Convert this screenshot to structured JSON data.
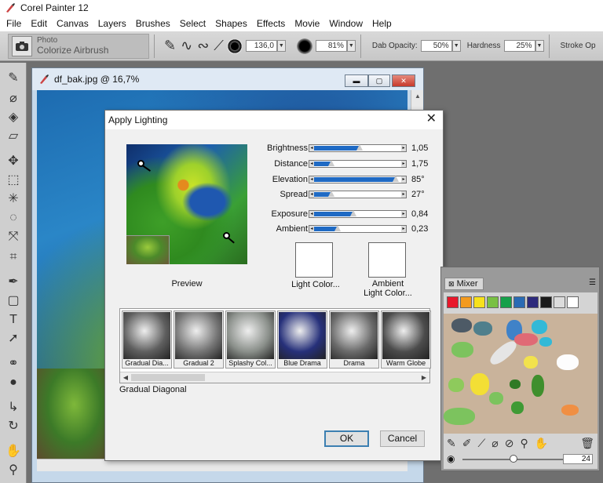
{
  "app": {
    "title": "Corel Painter 12",
    "icon": "painter-brush-icon"
  },
  "menu": [
    "File",
    "Edit",
    "Canvas",
    "Layers",
    "Brushes",
    "Select",
    "Shapes",
    "Effects",
    "Movie",
    "Window",
    "Help"
  ],
  "propbar": {
    "brush_category": "Photo",
    "brush_variant": "Colorize Airbrush",
    "size_value": "136,0",
    "opacity_value": "81%",
    "dab_opacity_label": "Dab Opacity:",
    "dab_opacity_value": "50%",
    "hardness_label": "Hardness",
    "hardness_value": "25%",
    "stroke_label": "Stroke Op"
  },
  "document": {
    "title": "df_bak.jpg @ 16,7%"
  },
  "dialog": {
    "title": "Apply Lighting",
    "preview_label": "Preview",
    "sliders": [
      {
        "label": "Brightness",
        "value": "1,05",
        "fraction": 0.52
      },
      {
        "label": "Distance",
        "value": "1,75",
        "fraction": 0.2
      },
      {
        "label": "Elevation",
        "value": "85°",
        "fraction": 0.94
      },
      {
        "label": "Spread",
        "value": "27°",
        "fraction": 0.2
      },
      {
        "label": "Exposure",
        "value": "0,84",
        "fraction": 0.45
      },
      {
        "label": "Ambient",
        "value": "0,23",
        "fraction": 0.27
      }
    ],
    "light_color_label": "Light Color...",
    "ambient_color_label_1": "Ambient",
    "ambient_color_label_2": "Light Color...",
    "library": [
      {
        "name": "Gradual Dia...",
        "color": "#5f5f5f"
      },
      {
        "name": "Gradual 2",
        "color": "#767676"
      },
      {
        "name": "Splashy Col...",
        "color": "#8a8f8a"
      },
      {
        "name": "Blue Drama",
        "color": "#26307a"
      },
      {
        "name": "Drama",
        "color": "#6a6a6a"
      },
      {
        "name": "Warm Globe",
        "color": "#4c4c4c"
      }
    ],
    "selected_name": "Gradual Diagonal",
    "ok_label": "OK",
    "cancel_label": "Cancel"
  },
  "mixer": {
    "title": "Mixer",
    "swatches": [
      "#e8182b",
      "#f39a1e",
      "#f7e11b",
      "#79c043",
      "#16a04a",
      "#2a6bb4",
      "#2d2a7c",
      "#1a1a1a",
      "#dcdcdc",
      "#ffffff"
    ],
    "size_value": "24"
  }
}
